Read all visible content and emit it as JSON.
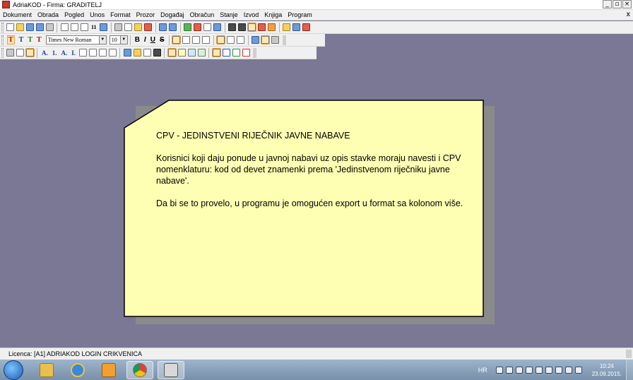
{
  "window": {
    "title": "AdriaKOD - Firma: GRADITELJ",
    "buttons": {
      "minimize": "_",
      "maximize": "▫",
      "close": "×"
    }
  },
  "menu": {
    "items": [
      "Dokument",
      "Obrada",
      "Pogled",
      "Unos",
      "Format",
      "Prozor",
      "Događaj",
      "Obračun",
      "Stanje",
      "Izvod",
      "Knjiga",
      "Program"
    ],
    "mdi_close": "x"
  },
  "toolbar_main": {
    "icons": [
      "new-document-icon",
      "open-folder-icon",
      "save-icon",
      "save-all-icon",
      "print-icon",
      "print-preview-icon",
      "find-icon",
      "find-next-icon",
      "11",
      "columns-icon",
      "cut-icon",
      "copy-icon",
      "paste-icon",
      "delete-icon",
      "undo-icon",
      "redo-icon",
      "refresh-icon",
      "home-icon",
      "window-icon",
      "calculator-icon",
      "copy-window-icon",
      "truck-icon",
      "zoom-icon",
      "user-icon",
      "edit-icon",
      "help-icon",
      "check-icon",
      "exit-icon"
    ],
    "page_number_label": "11"
  },
  "toolbar_format": {
    "font_name": "Times New Roman",
    "font_size": "10",
    "style_buttons": {
      "bold": "B",
      "italic": "I",
      "underline": "U",
      "strike": "S"
    },
    "text_color_labels": [
      "T",
      "T",
      "T",
      "T"
    ]
  },
  "toolbar_paragraph": {
    "list_labels": [
      "A.",
      "1.",
      "A.",
      "I."
    ]
  },
  "note": {
    "heading": "CPV - JEDINSTVENI RIJEČNIK JAVNE NABAVE",
    "paragraph1": "Korisnici koji daju ponude u javnoj nabavi uz opis stavke moraju navesti i CPV nomenklaturu: kod od devet znamenki prema 'Jedinstvenom riječniku javne nabave'.",
    "paragraph2": "Da bi se to provelo, u programu je omogućen export u format sa kolonom više.",
    "colors": {
      "paper": "#ffffb3",
      "border": "#000000",
      "shadow": "#8a8a8a"
    }
  },
  "statusbar": {
    "licence": "Licenca:  [A1] ADRIAKOD LOGIN CRIKVENICA"
  },
  "taskbar": {
    "apps": [
      "windows-start-icon",
      "folder-icon",
      "internet-explorer-icon",
      "media-player-icon",
      "chrome-icon",
      "adriakod-app-icon"
    ],
    "language": "HR",
    "time": "10:24",
    "date": "23.09.2015."
  },
  "colors": {
    "desktop_background": "#7a7894",
    "toolbar_background": "#f0f0f0"
  }
}
